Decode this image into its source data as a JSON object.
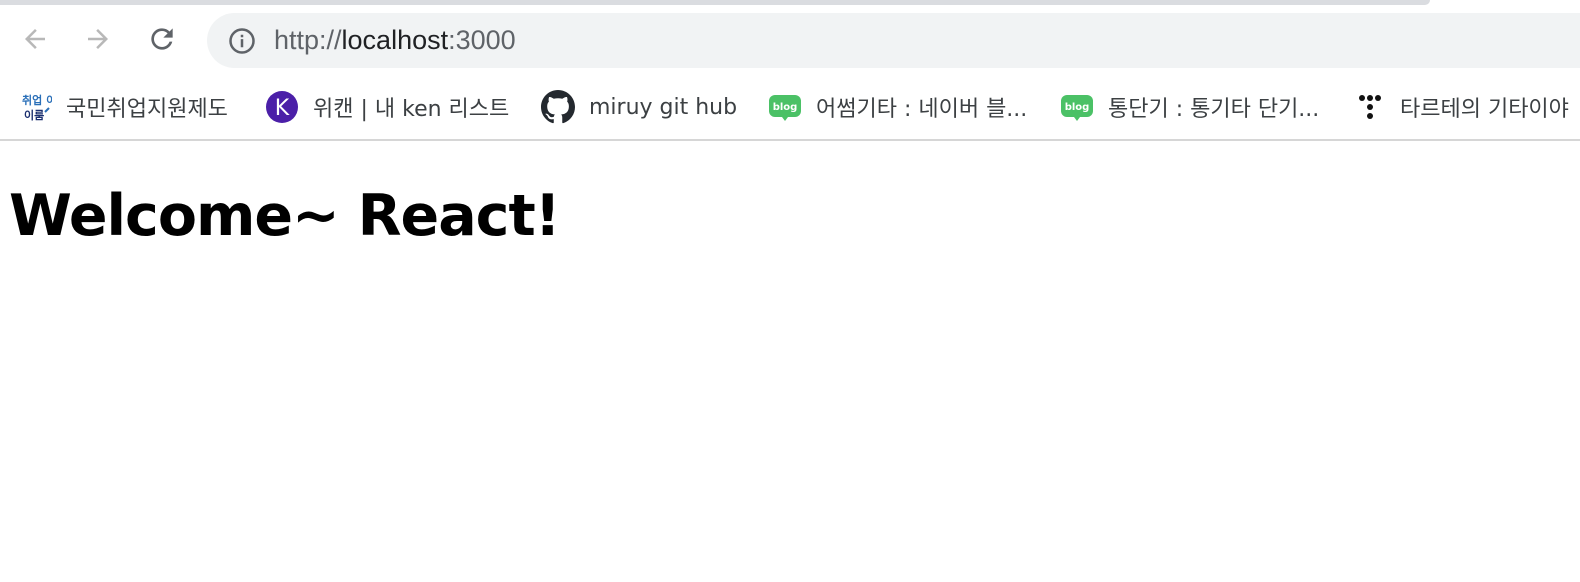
{
  "browser": {
    "address_bar": {
      "scheme": "http://",
      "host": "localhost",
      "port": ":3000"
    },
    "nav": {
      "back_icon": "arrow-left-icon",
      "forward_icon": "arrow-right-icon",
      "reload_icon": "reload-icon",
      "info_icon": "info-circle-icon"
    },
    "bookmarks": [
      {
        "label": "국민취업지원제도",
        "icon": "employment-logo-icon",
        "icon_text": "취업 이룸"
      },
      {
        "label": "위캔 | 내 ken 리스트",
        "icon": "k-circle-icon",
        "icon_text": "K",
        "color": "#4b1fa8"
      },
      {
        "label": "miruy git hub",
        "icon": "github-icon"
      },
      {
        "label": "어썸기타 : 네이버 블...",
        "icon": "naver-blog-icon",
        "icon_text": "blog",
        "color": "#4bc166"
      },
      {
        "label": "통단기 : 통기타 단기...",
        "icon": "naver-blog-icon",
        "icon_text": "blog",
        "color": "#4bc166"
      },
      {
        "label": "타르테의 기타이야",
        "icon": "dots-logo-icon"
      }
    ]
  },
  "page": {
    "heading": "Welcome~ React!"
  }
}
